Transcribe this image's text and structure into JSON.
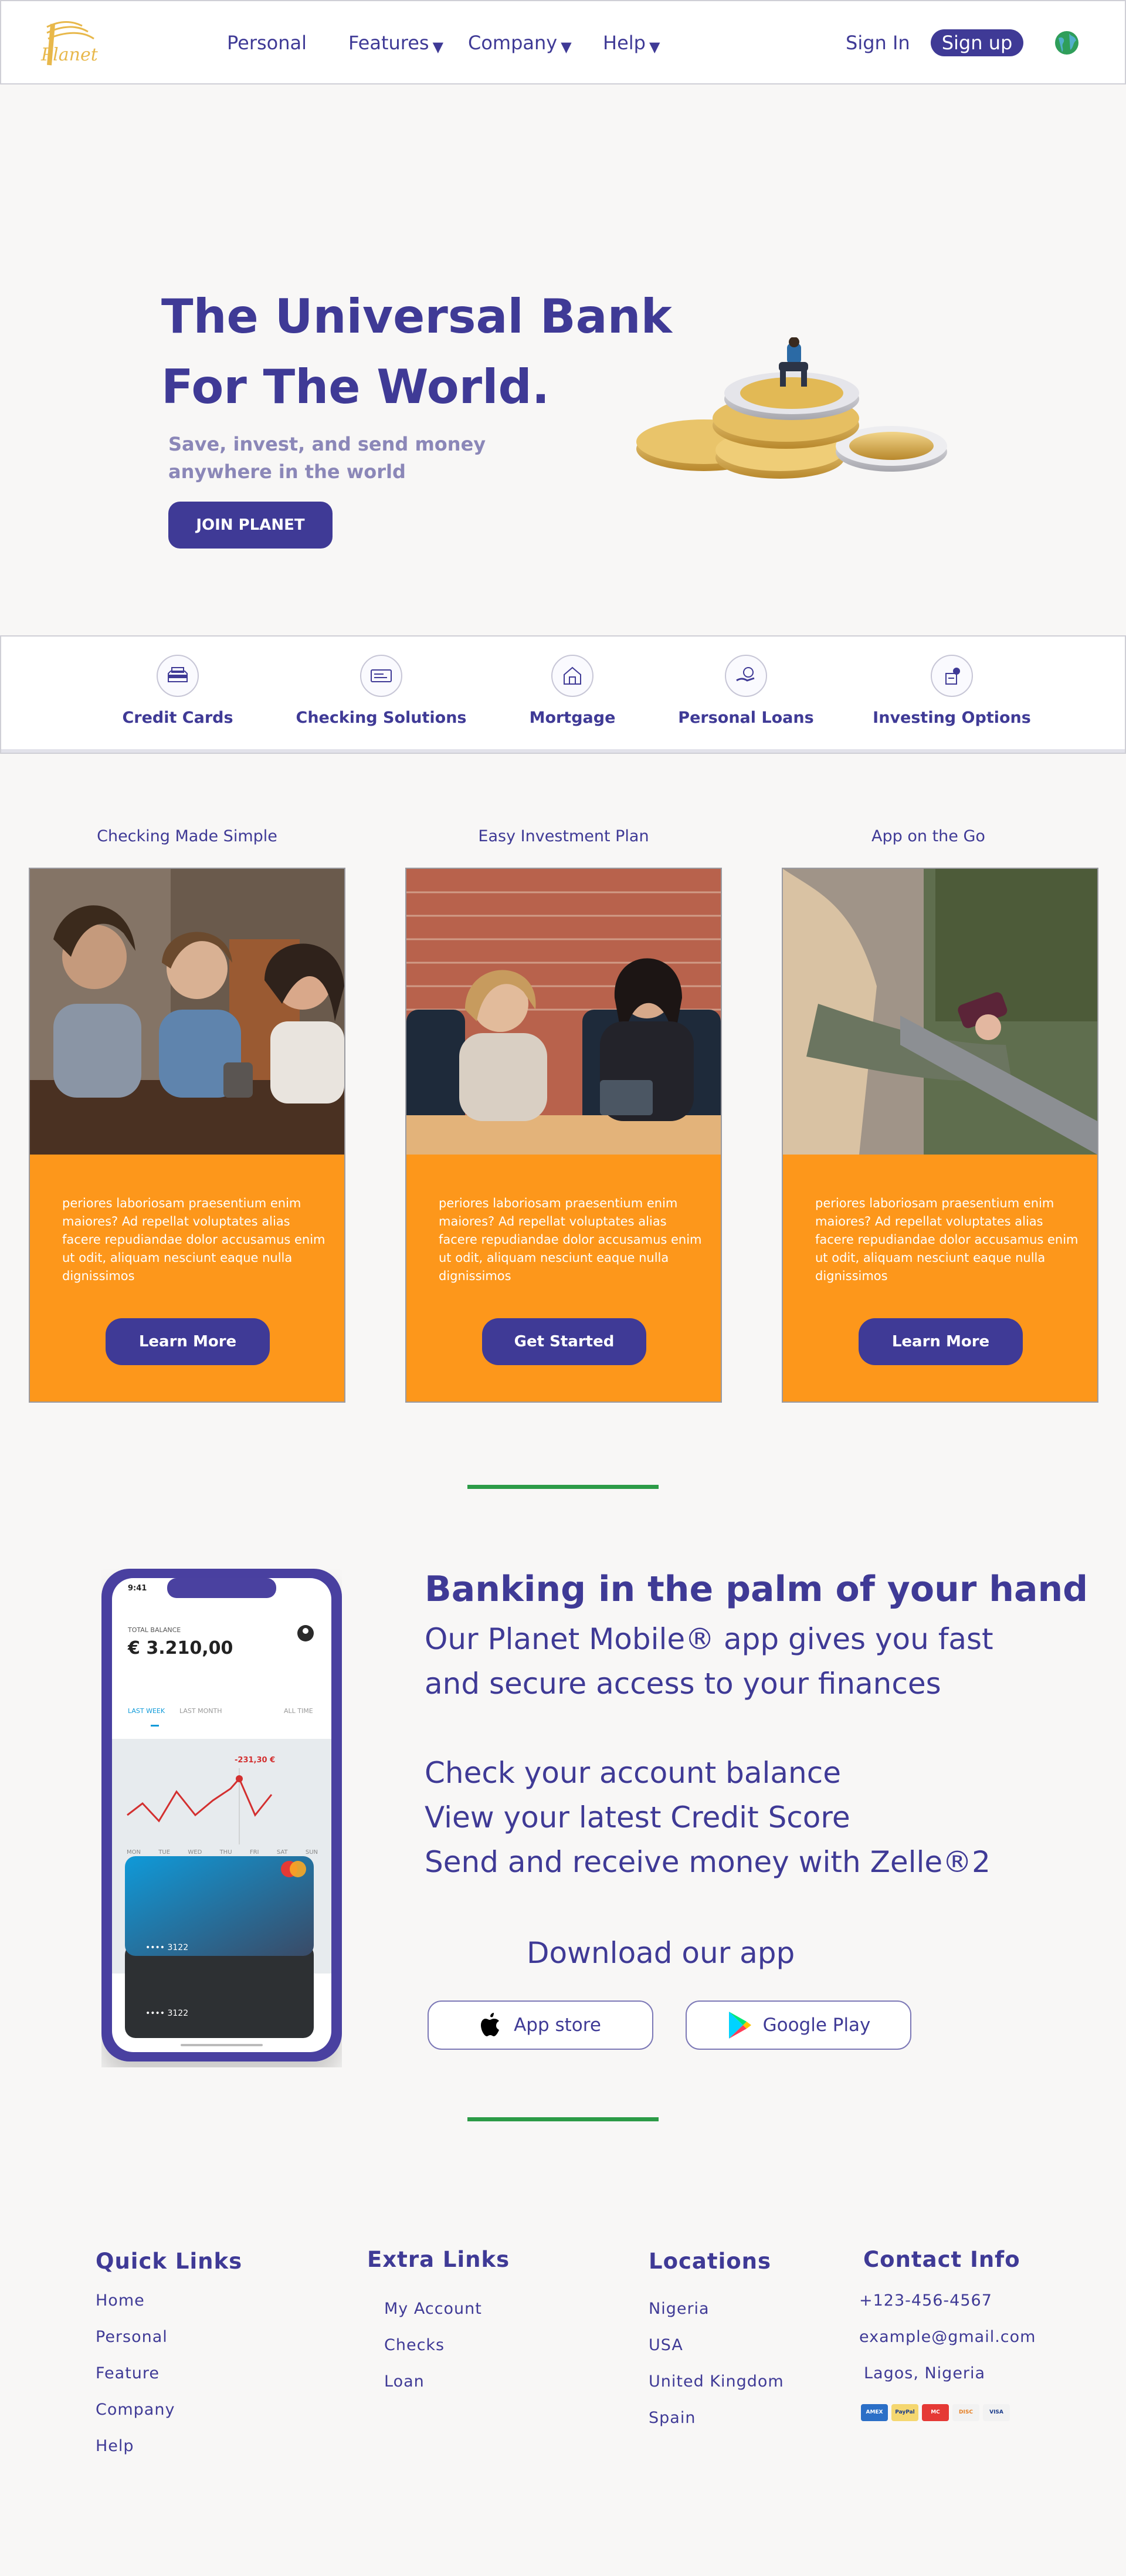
{
  "nav": {
    "logo_text": "Planet",
    "links": [
      {
        "label": "Personal",
        "caret": false
      },
      {
        "label": "Features",
        "caret": true
      },
      {
        "label": "Company",
        "caret": true
      },
      {
        "label": "Help",
        "caret": true
      }
    ],
    "signin": "Sign In",
    "signup": "Sign up",
    "caret_glyph": "▼"
  },
  "hero": {
    "title_line1": "The Universal Bank",
    "title_line2": "For The World.",
    "subtitle_line1": "Save, invest, and send money",
    "subtitle_line2": "anywhere in the world",
    "cta": "JOIN PLANET"
  },
  "services": [
    {
      "label": "Credit Cards",
      "icon": "credit-card-icon"
    },
    {
      "label": "Checking Solutions",
      "icon": "checking-icon"
    },
    {
      "label": "Mortgage",
      "icon": "house-icon"
    },
    {
      "label": "Personal Loans",
      "icon": "loan-icon"
    },
    {
      "label": "Investing Options",
      "icon": "investing-icon"
    }
  ],
  "cards": [
    {
      "title": "Checking Made Simple",
      "text": "periores laboriosam praesentium enim maiores? Ad repellat voluptates alias facere repudiandae dolor accusamus enim ut odit, aliquam nesciunt eaque nulla dignissimos",
      "button": "Learn More"
    },
    {
      "title": "Easy Investment Plan",
      "text": "periores laboriosam praesentium enim maiores? Ad repellat voluptates alias facere repudiandae dolor accusamus enim ut odit, aliquam nesciunt eaque nulla dignissimos",
      "button": "Get Started"
    },
    {
      "title": "App on the Go",
      "text": "periores laboriosam praesentium enim maiores? Ad repellat voluptates alias facere repudiandae dolor accusamus enim ut odit, aliquam nesciunt eaque nulla dignissimos",
      "button": "Learn More"
    }
  ],
  "app": {
    "title": "Banking in the palm of your hand",
    "intro_line1": "Our Planet Mobile® app gives you fast",
    "intro_line2": "and secure access to your finances",
    "features": [
      "Check your account balance",
      "View your latest Credit Score",
      "Send and receive money with Zelle®2"
    ],
    "download": "Download our app",
    "appstore": "App store",
    "googleplay": "Google Play"
  },
  "phone": {
    "time": "9:41",
    "balance_label": "TOTAL BALANCE",
    "balance": "€ 3.210,00",
    "tabs": [
      "LAST WEEK",
      "LAST MONTH",
      "ALL TIME"
    ],
    "change": "-231,30 €",
    "days": [
      "MON",
      "TUE",
      "WED",
      "THU",
      "FRI",
      "SAT",
      "SUN"
    ],
    "card1": "•••• 3122",
    "card2": "•••• 3122"
  },
  "footer": {
    "quick": {
      "heading": "Quick Links",
      "links": [
        "Home",
        "Personal",
        "Feature",
        "Company",
        "Help"
      ]
    },
    "extra": {
      "heading": "Extra Links",
      "links": [
        "My Account",
        "Checks",
        "Loan"
      ]
    },
    "locations": {
      "heading": "Locations",
      "links": [
        "Nigeria",
        "USA",
        "United Kingdom",
        "Spain"
      ]
    },
    "contact": {
      "heading": "Contact Info",
      "phone": "+123-456-4567",
      "email": "example@gmail.com",
      "address": "Lagos, Nigeria"
    },
    "payments": [
      "AMEX",
      "PayPal",
      "MC",
      "DISC",
      "VISA"
    ]
  },
  "colors": {
    "brand": "#3f3a96",
    "accent_orange": "#fd971b",
    "divider_green": "#2c9b47",
    "logo_gold": "#e8b84b"
  }
}
